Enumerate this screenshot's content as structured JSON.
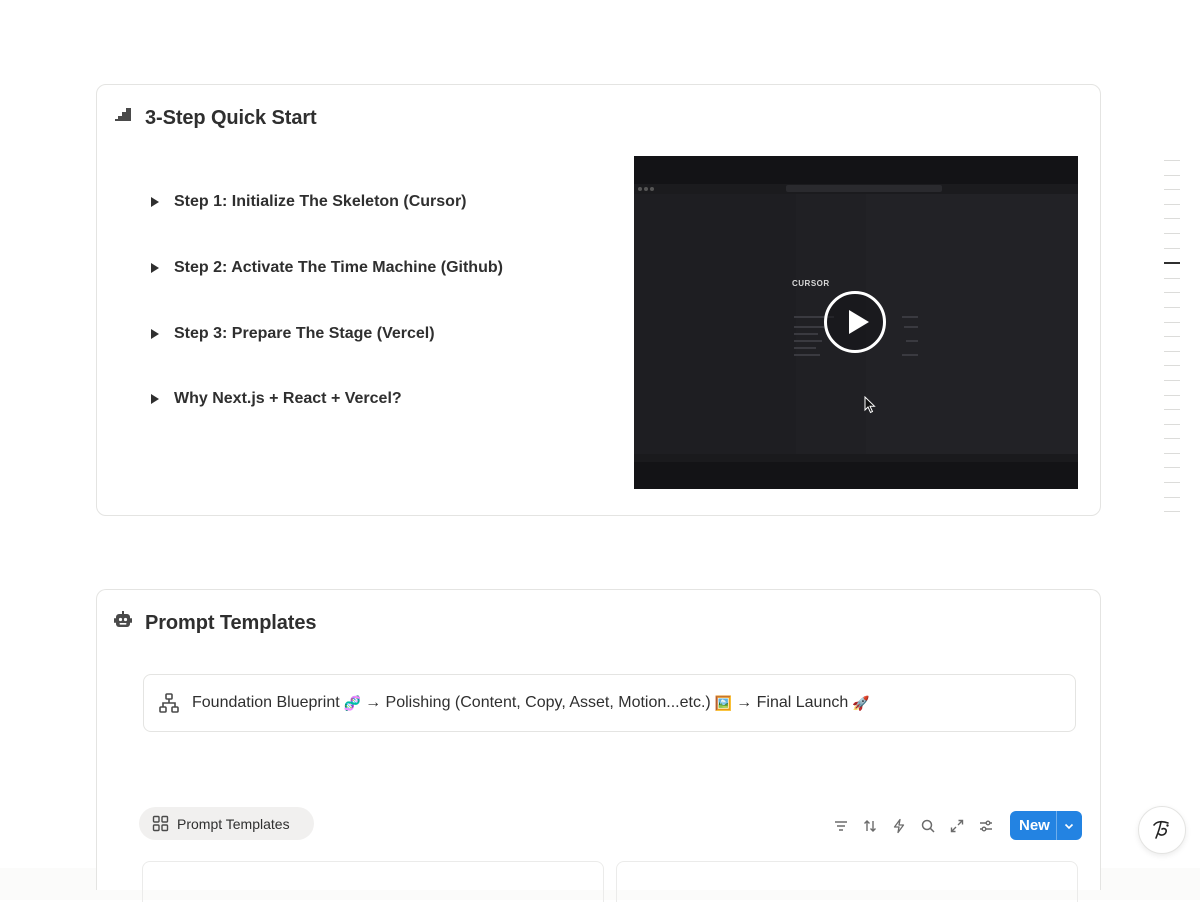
{
  "quick_start": {
    "title": "3-Step Quick Start",
    "steps": [
      "Step 1: Initialize The Skeleton (Cursor)",
      "Step 2: Activate The Time Machine (Github)",
      "Step 3: Prepare The Stage (Vercel)",
      "Why Next.js + React + Vercel?"
    ],
    "video": {
      "logo_text": "CURSOR"
    }
  },
  "prompt_templates": {
    "title": "Prompt Templates",
    "callout": {
      "part1": "Foundation Blueprint",
      "emoji1": "🧬",
      "part2": "→ Polishing (Content, Copy, Asset, Motion...etc.)",
      "emoji2": "🖼️",
      "part3": "→ Final Launch",
      "emoji3": "🚀"
    },
    "view_tab_label": "Prompt Templates",
    "toolbar": {
      "icons": [
        "filter-icon",
        "sort-icon",
        "automation-icon",
        "search-icon",
        "expand-icon",
        "settings-icon"
      ],
      "new_label": "New"
    }
  },
  "colors": {
    "accent": "#2383e2",
    "text": "#2f2f2f",
    "border": "#e4e4e2"
  }
}
